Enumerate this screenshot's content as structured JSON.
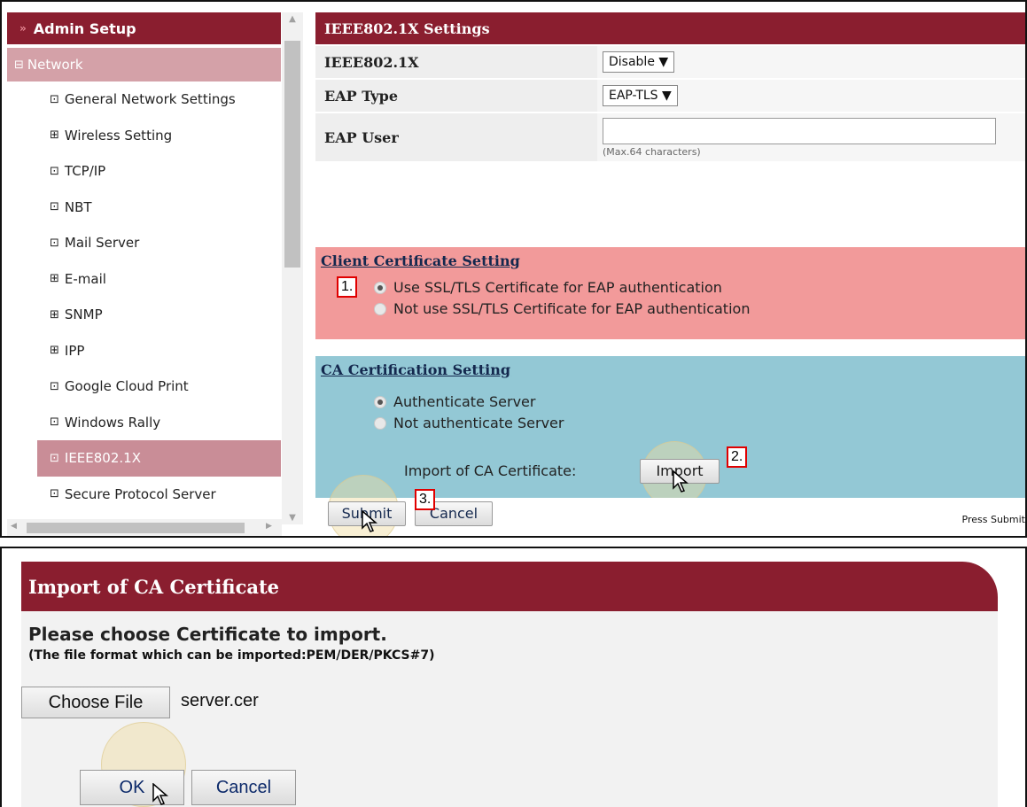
{
  "sidebar": {
    "header": "Admin Setup",
    "network": "Network",
    "items": [
      {
        "label": "General Network Settings",
        "glyph": "⊡"
      },
      {
        "label": "Wireless Setting",
        "glyph": "⊞"
      },
      {
        "label": "TCP/IP",
        "glyph": "⊡"
      },
      {
        "label": "NBT",
        "glyph": "⊡"
      },
      {
        "label": "Mail Server",
        "glyph": "⊡"
      },
      {
        "label": "E-mail",
        "glyph": "⊞"
      },
      {
        "label": "SNMP",
        "glyph": "⊞"
      },
      {
        "label": "IPP",
        "glyph": "⊞"
      },
      {
        "label": "Google Cloud Print",
        "glyph": "⊡"
      },
      {
        "label": "Windows Rally",
        "glyph": "⊡"
      },
      {
        "label": "IEEE802.1X",
        "glyph": "⊡",
        "active": true
      },
      {
        "label": "Secure Protocol Server",
        "glyph": "⊡"
      }
    ]
  },
  "settings": {
    "title": "IEEE802.1X Settings",
    "ieee_label": "IEEE802.1X",
    "ieee_value": "Disable ▼",
    "eap_type_label": "EAP Type",
    "eap_type_value": "EAP-TLS ▼",
    "eap_user_label": "EAP User",
    "eap_user_value": "",
    "eap_user_hint": "(Max.64 characters)"
  },
  "client_cert": {
    "title": "Client Certificate Setting",
    "option_use": "Use SSL/TLS Certificate for EAP authentication",
    "option_not_use": "Not use SSL/TLS Certificate for EAP authentication",
    "selected": "use"
  },
  "ca_cert": {
    "title": "CA Certification Setting",
    "option_auth": "Authenticate Server",
    "option_not_auth": "Not authenticate Server",
    "selected": "auth",
    "import_label": "Import of CA Certificate:",
    "import_button": "Import"
  },
  "footer": {
    "submit": "Submit",
    "cancel": "Cancel",
    "note": "Press Submit"
  },
  "markers": {
    "m1": "1.",
    "m2": "2.",
    "m3": "3."
  },
  "dialog": {
    "title": "Import of CA Certificate",
    "heading": "Please choose Certificate to import.",
    "subheading": "(The file format which can be imported:PEM/DER/PKCS#7)",
    "choose_file": "Choose File",
    "file_name": "server.cer",
    "ok": "OK",
    "cancel": "Cancel"
  },
  "colors": {
    "header_maroon": "#8a1e2f",
    "client_box": "#f29a9a",
    "ca_box": "#93c8d5",
    "marker_border": "#e00000"
  }
}
